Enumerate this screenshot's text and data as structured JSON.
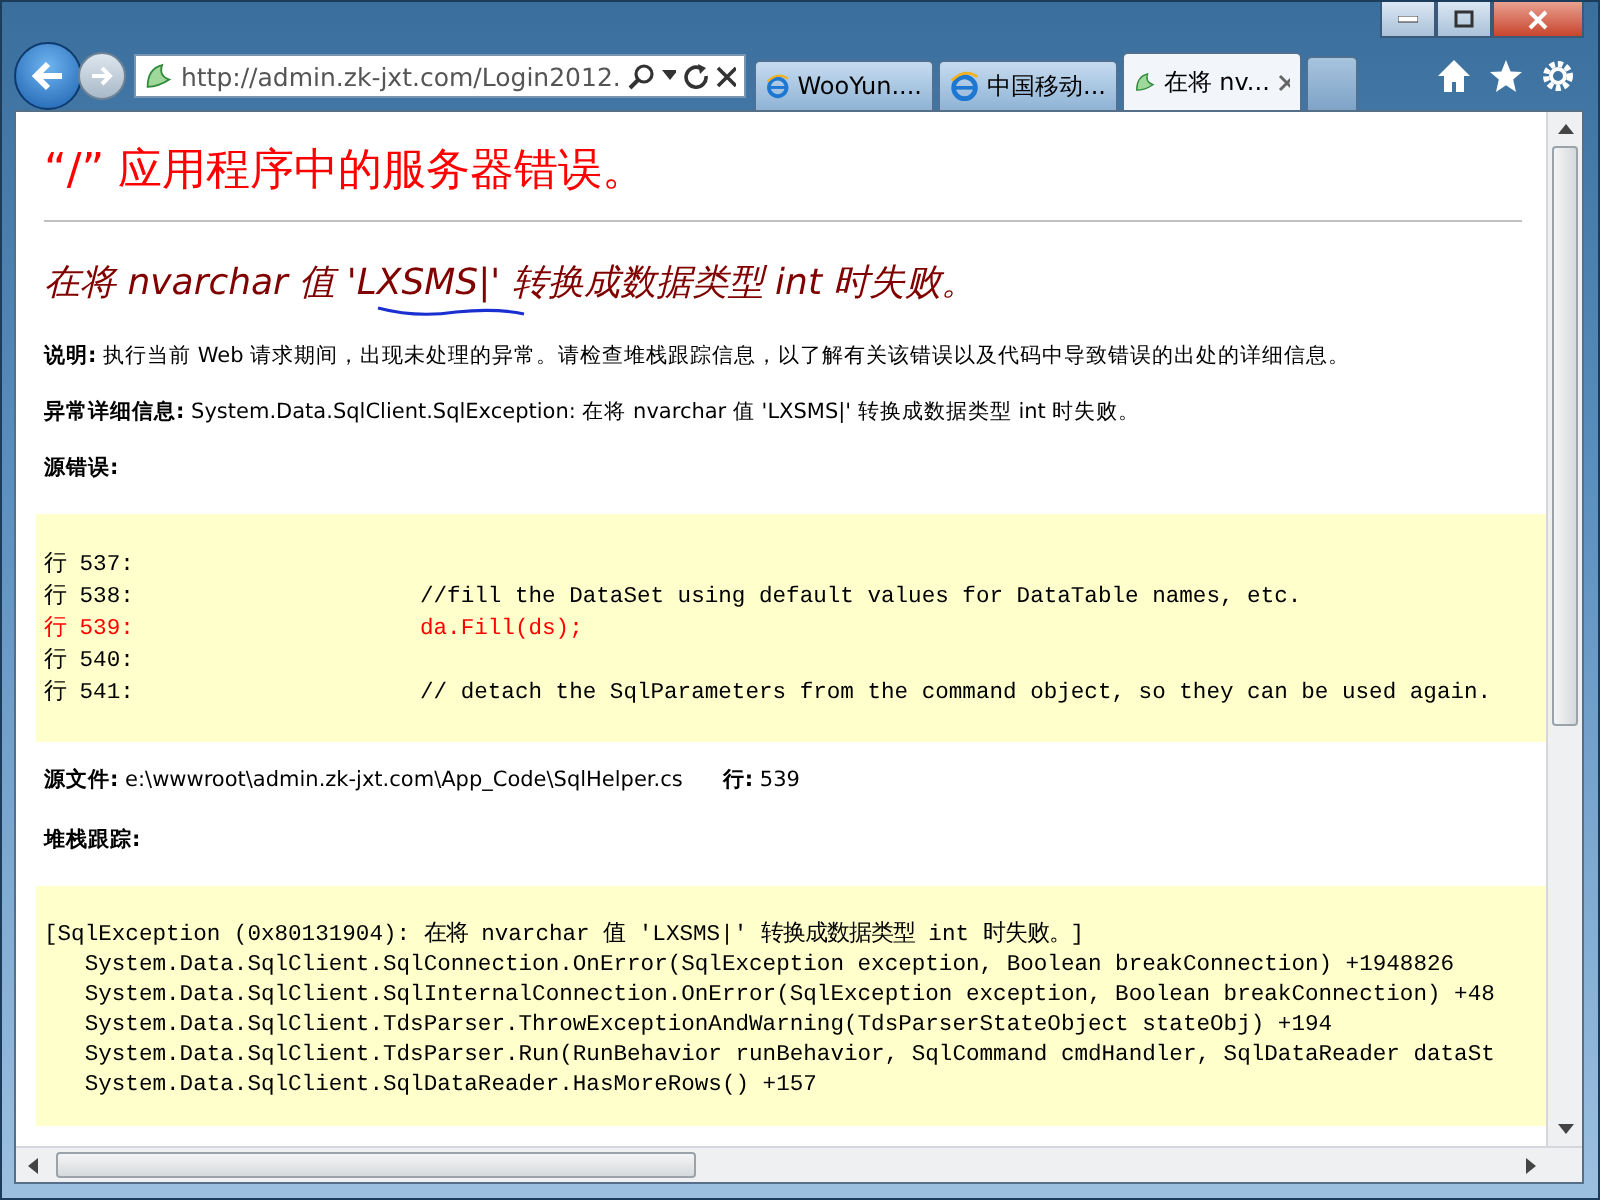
{
  "browser": {
    "address": "http://admin.zk-jxt.com/Login2012.",
    "tabs": [
      {
        "title": "WooYun....",
        "kind": "ie",
        "selected": false
      },
      {
        "title": "中国移动...",
        "kind": "ie",
        "selected": false
      },
      {
        "title": "在将 nv...",
        "kind": "site",
        "selected": true
      }
    ]
  },
  "page": {
    "heading": "“/” 应用程序中的服务器错误。",
    "error_title": "在将 nvarchar 值 'LXSMS|' 转换成数据类型 int 时失败。",
    "description": "**说明:** 执行当前 Web 请求期间，出现未处理的异常。请检查堆栈跟踪信息，以了解有关该错误以及代码中导致错误的出处的详细信息。",
    "exception_details": "**异常详细信息:** System.Data.SqlClient.SqlException: 在将 nvarchar 值 'LXSMS|' 转换成数据类型 int 时失败。",
    "source_error_heading": "源错误:",
    "source_lines": [
      {
        "line": "行 537:",
        "highlighted": false
      },
      {
        "line": "行 538:",
        "code": "//fill the DataSet using default values for DataTable names, etc.",
        "highlighted": false
      },
      {
        "line": "行 539:",
        "code": "da.Fill(ds);",
        "highlighted": true
      },
      {
        "line": "行 540:",
        "highlighted": false
      },
      {
        "line": "行 541:",
        "code": "// detach the SqlParameters from the command object, so they can be used again.",
        "highlighted": false
      }
    ],
    "source_file": {
      "label": "源文件:",
      "value": "e:\\wwwroot\\admin.zk-jxt.com\\App_Code\\SqlHelper.cs"
    },
    "source_line": {
      "label": "行:",
      "value": "539"
    },
    "stack_trace_heading": "堆栈跟踪:",
    "stack_trace": [
      "[SqlException (0x80131904): 在将 nvarchar 值 'LXSMS|' 转换成数据类型 int 时失败。]",
      "   System.Data.SqlClient.SqlConnection.OnError(SqlException exception, Boolean breakConnection) +1948826",
      "   System.Data.SqlClient.SqlInternalConnection.OnError(SqlException exception, Boolean breakConnection) +48",
      "   System.Data.SqlClient.TdsParser.ThrowExceptionAndWarning(TdsParserStateObject stateObj) +194",
      "   System.Data.SqlClient.TdsParser.Run(RunBehavior runBehavior, SqlCommand cmdHandler, SqlDataReader dataSt",
      "   System.Data.SqlClient.SqlDataReader.HasMoreRows() +157"
    ]
  }
}
